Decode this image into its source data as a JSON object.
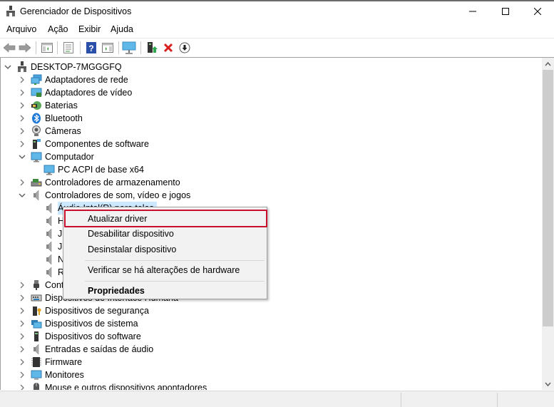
{
  "window": {
    "title": "Gerenciador de Dispositivos",
    "controls": {
      "minimize": "minimize",
      "maximize": "maximize",
      "close": "close"
    }
  },
  "menubar": {
    "items": [
      {
        "label": "Arquivo"
      },
      {
        "label": "Ação"
      },
      {
        "label": "Exibir"
      },
      {
        "label": "Ajuda"
      }
    ]
  },
  "toolbar": {
    "buttons": [
      {
        "icon": "back-arrow-icon"
      },
      {
        "icon": "forward-arrow-icon"
      },
      {
        "icon": "show-hide-console-tree-icon"
      },
      {
        "icon": "properties-icon"
      },
      {
        "icon": "help-icon"
      },
      {
        "icon": "show-action-pane-icon"
      },
      {
        "icon": "scan-hardware-monitor-icon"
      },
      {
        "icon": "update-driver-icon"
      },
      {
        "icon": "uninstall-x-icon"
      },
      {
        "icon": "download-circle-icon"
      }
    ]
  },
  "tree": {
    "root": {
      "label": "DESKTOP-7MGGGFQ",
      "expanded": true
    },
    "items": [
      {
        "label": "Adaptadores de rede",
        "icon": "network-adapter-icon",
        "expanded": false,
        "level": 1
      },
      {
        "label": "Adaptadores de vídeo",
        "icon": "display-adapter-icon",
        "expanded": false,
        "level": 1
      },
      {
        "label": "Baterias",
        "icon": "battery-icon",
        "expanded": false,
        "level": 1
      },
      {
        "label": "Bluetooth",
        "icon": "bluetooth-icon",
        "expanded": false,
        "level": 1
      },
      {
        "label": "Câmeras",
        "icon": "camera-icon",
        "expanded": false,
        "level": 1
      },
      {
        "label": "Componentes de software",
        "icon": "software-component-icon",
        "expanded": false,
        "level": 1
      },
      {
        "label": "Computador",
        "icon": "computer-icon",
        "expanded": true,
        "level": 1
      },
      {
        "label": "PC ACPI de base x64",
        "icon": "computer-icon",
        "level": 2
      },
      {
        "label": "Controladores de armazenamento",
        "icon": "storage-controller-icon",
        "expanded": false,
        "level": 1
      },
      {
        "label": "Controladores de som, vídeo e jogos",
        "icon": "speaker-icon",
        "expanded": true,
        "level": 1
      },
      {
        "label": "Áudio Intel(R) para telas",
        "icon": "speaker-icon",
        "level": 2,
        "selected": true
      },
      {
        "label": "H",
        "icon": "speaker-icon",
        "level": 2
      },
      {
        "label": "JI",
        "icon": "speaker-icon",
        "level": 2
      },
      {
        "label": "JI",
        "icon": "speaker-icon",
        "level": 2
      },
      {
        "label": "N",
        "icon": "speaker-icon",
        "level": 2
      },
      {
        "label": "R",
        "icon": "speaker-icon",
        "level": 2
      },
      {
        "label": "Controladores USB",
        "icon": "usb-icon",
        "expanded": false,
        "level": 1
      },
      {
        "label": "Dispositivos de Interface Humana",
        "icon": "hid-keyboard-icon",
        "expanded": false,
        "level": 1
      },
      {
        "label": "Dispositivos de segurança",
        "icon": "security-device-icon",
        "expanded": false,
        "level": 1
      },
      {
        "label": "Dispositivos de sistema",
        "icon": "system-device-icon",
        "expanded": false,
        "level": 1
      },
      {
        "label": "Dispositivos do software",
        "icon": "software-device-icon",
        "expanded": false,
        "level": 1
      },
      {
        "label": "Entradas e saídas de áudio",
        "icon": "speaker-icon",
        "expanded": false,
        "level": 1
      },
      {
        "label": "Firmware",
        "icon": "firmware-chip-icon",
        "expanded": false,
        "level": 1
      },
      {
        "label": "Monitores",
        "icon": "monitor-icon",
        "expanded": false,
        "level": 1
      },
      {
        "label": "Mouse e outros dispositivos apontadores",
        "icon": "mouse-icon",
        "expanded": false,
        "level": 1
      }
    ]
  },
  "context_menu": {
    "items": [
      {
        "label": "Atualizar driver",
        "highlighted": true
      },
      {
        "label": "Desabilitar dispositivo"
      },
      {
        "label": "Desinstalar dispositivo"
      },
      {
        "separator": true
      },
      {
        "label": "Verificar se há alterações de hardware"
      },
      {
        "separator": true
      },
      {
        "label": "Propriedades",
        "bold": true
      }
    ]
  },
  "colors": {
    "highlight_border": "#c8102e",
    "selection_bg": "#cce8ff",
    "menu_bg": "#f2f2f2",
    "statusbar_bg": "#f0f0f0"
  }
}
